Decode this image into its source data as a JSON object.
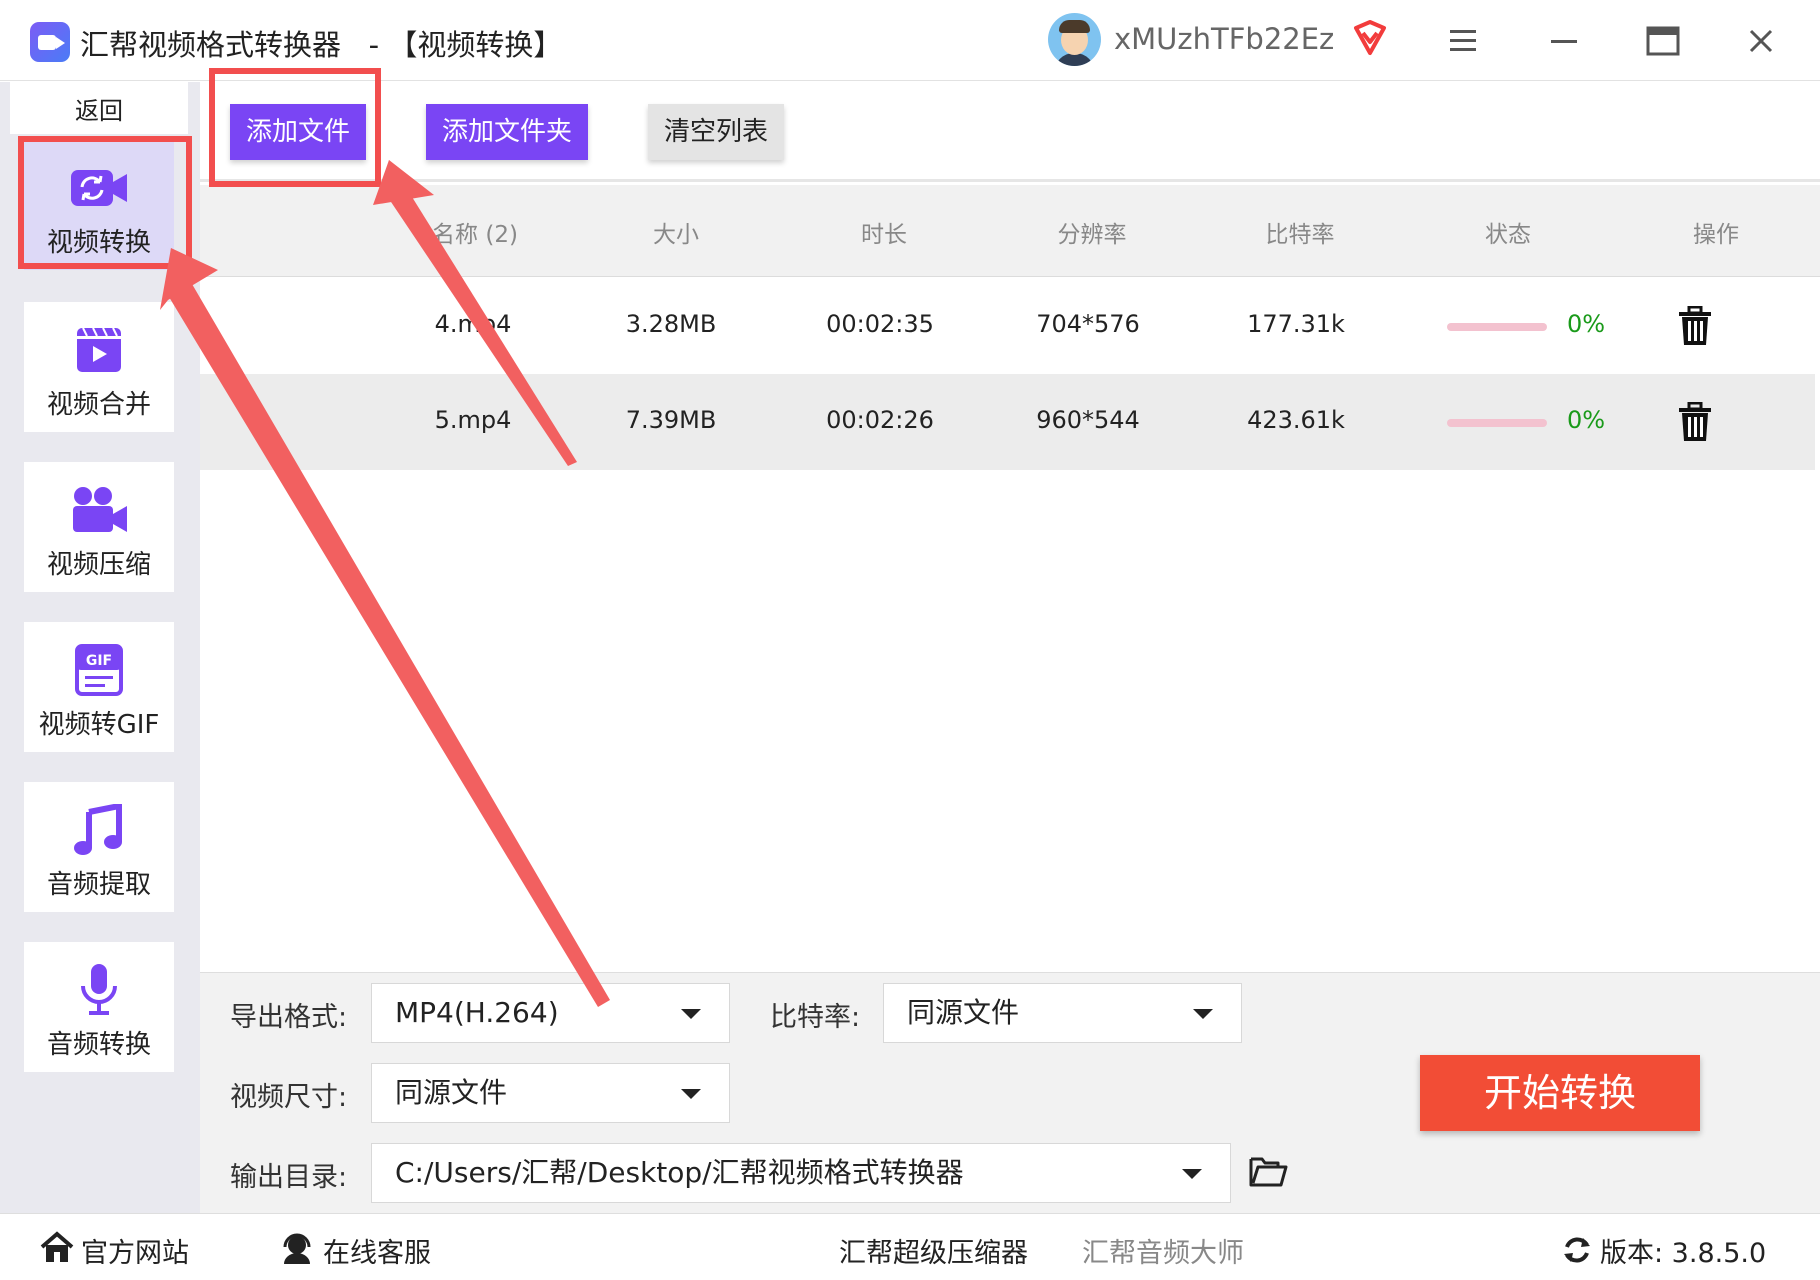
{
  "window": {
    "title": "汇帮视频格式转换器   - 【视频转换】",
    "username": "xMUzhTFb22Ez",
    "icons": [
      "app-icon",
      "avatar",
      "vip-icon",
      "menu-icon",
      "minimize-icon",
      "maximize-icon",
      "close-icon"
    ]
  },
  "sidebar": {
    "back_label": "返回",
    "items": [
      {
        "label": "视频转换",
        "icon": "video-convert-icon",
        "active": true
      },
      {
        "label": "视频合并",
        "icon": "video-merge-icon"
      },
      {
        "label": "视频压缩",
        "icon": "video-compress-icon"
      },
      {
        "label": "视频转GIF",
        "icon": "gif-icon"
      },
      {
        "label": "音频提取",
        "icon": "music-note-icon"
      },
      {
        "label": "音频转换",
        "icon": "microphone-icon"
      }
    ]
  },
  "toolbar": {
    "add_file": "添加文件",
    "add_folder": "添加文件夹",
    "clear_list": "清空列表"
  },
  "table": {
    "columns": [
      "名称 (2)",
      "大小",
      "时长",
      "分辨率",
      "比特率",
      "状态",
      "操作"
    ],
    "rows": [
      {
        "name": "4.mp4",
        "size": "3.28MB",
        "duration": "00:02:35",
        "resolution": "704*576",
        "bitrate": "177.31k",
        "progress": 0,
        "status": "0%"
      },
      {
        "name": "5.mp4",
        "size": "7.39MB",
        "duration": "00:02:26",
        "resolution": "960*544",
        "bitrate": "423.61k",
        "progress": 0,
        "status": "0%"
      }
    ]
  },
  "settings": {
    "format_label": "导出格式:",
    "format_value": "MP4(H.264)",
    "bitrate_label": "比特率:",
    "bitrate_value": "同源文件",
    "size_label": "视频尺寸:",
    "size_value": "同源文件",
    "outdir_label": "输出目录:",
    "outdir_value": "C:/Users/汇帮/Desktop/汇帮视频格式转换器",
    "start_label": "开始转换"
  },
  "footer": {
    "official_site": "官方网站",
    "online_service": "在线客服",
    "compressor": "汇帮超级压缩器",
    "audio_master": "汇帮音频大师",
    "version": "版本: 3.8.5.0"
  },
  "colors": {
    "accent": "#7a45f4",
    "start_button": "#f24d36",
    "annotation": "#f24e4e",
    "status_text": "#1a9a1a",
    "progress_track": "#f3c2cf"
  }
}
